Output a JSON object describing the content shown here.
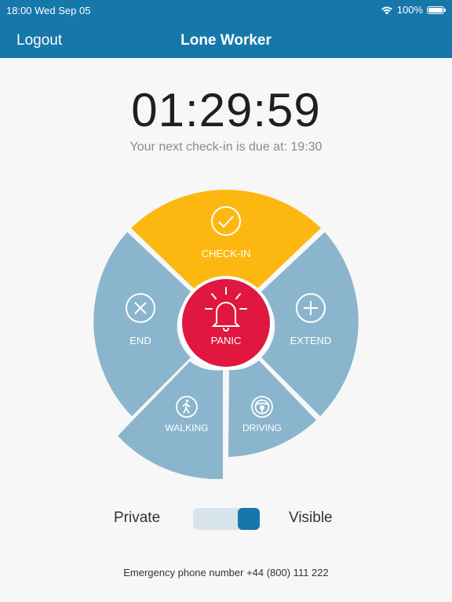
{
  "status_bar": {
    "time": "18:00 Wed Sep 05",
    "battery_text": "100%",
    "battery_level": 1.0
  },
  "nav": {
    "logout_label": "Logout",
    "title": "Lone Worker"
  },
  "timer": {
    "value": "01:29:59",
    "next_checkin": "Your next check-in is due at: 19:30"
  },
  "wheel": {
    "check_in_label": "CHECK-IN",
    "end_label": "END",
    "extend_label": "EXTEND",
    "walking_label": "WALKING",
    "driving_label": "DRIVING",
    "panic_label": "PANIC",
    "colors": {
      "check_in": "#fcb811",
      "segment": "#8ab5cd",
      "panic": "#e0173f"
    },
    "icons": {
      "check_in": "checkmark-circle-icon",
      "end": "close-circle-icon",
      "extend": "plus-circle-icon",
      "walking": "walking-person-icon",
      "driving": "steering-wheel-icon",
      "panic": "alarm-bell-icon"
    }
  },
  "visibility": {
    "private_label": "Private",
    "visible_label": "Visible",
    "value": "Visible"
  },
  "footer": {
    "emergency_text": "Emergency phone number +44 (800) 111 222"
  },
  "colors": {
    "header": "#1677ab",
    "background": "#f7f7f7"
  }
}
